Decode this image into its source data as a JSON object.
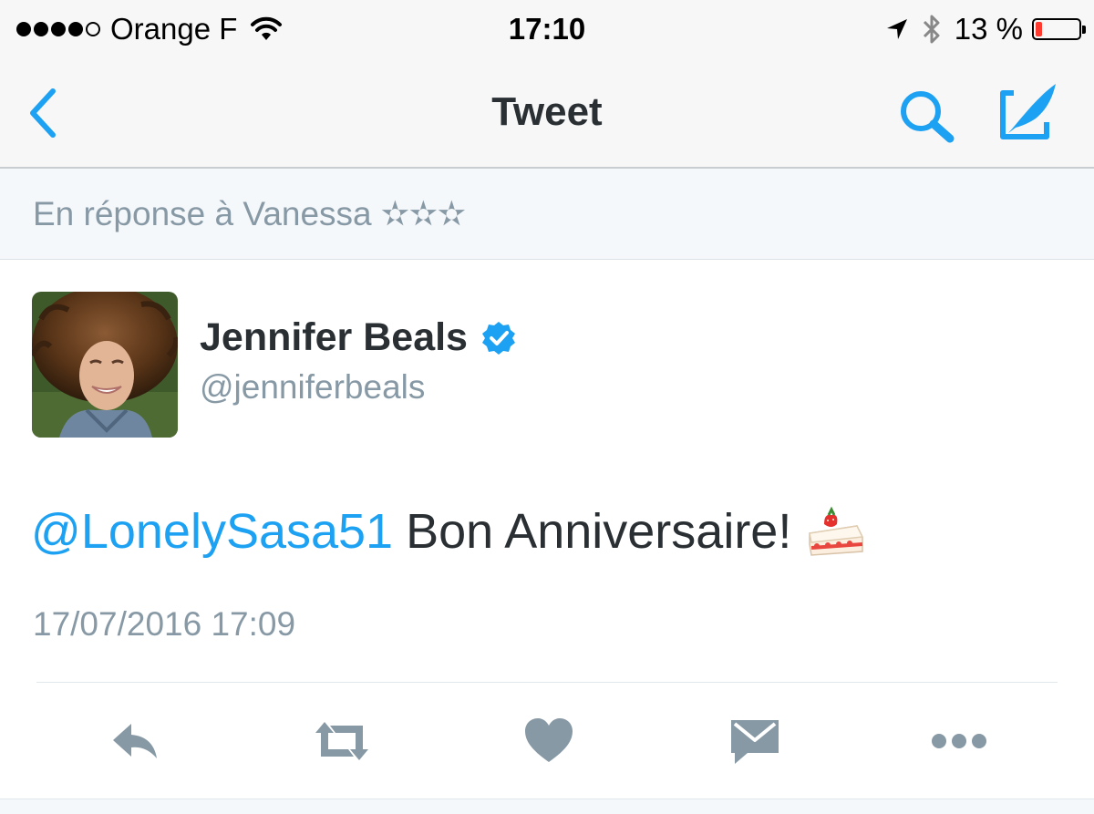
{
  "status_bar": {
    "signal_dots_filled": 4,
    "signal_dots_total": 5,
    "carrier": "Orange F",
    "time": "17:10",
    "battery_percent_label": "13 %",
    "battery_level": 0.13,
    "icons": [
      "wifi-icon",
      "location-arrow-icon",
      "bluetooth-icon",
      "battery-icon"
    ]
  },
  "nav": {
    "title": "Tweet",
    "icons": [
      "back-chevron-icon",
      "search-icon",
      "compose-icon"
    ]
  },
  "reply_context": {
    "text": "En réponse à Vanessa ✫✫✫"
  },
  "tweet": {
    "author_name": "Jennifer Beals",
    "author_handle": "@jenniferbeals",
    "verified": true,
    "mention": "@LonelySasa51",
    "text": "Bon Anniversaire!",
    "emoji": "shortcake-icon",
    "timestamp": "17/07/2016 17:09"
  },
  "actions": {
    "icons": [
      "reply-icon",
      "retweet-icon",
      "like-icon",
      "direct-message-icon",
      "more-icon"
    ]
  },
  "colors": {
    "accent": "#1da1f2",
    "action_icon": "#8899a6",
    "text": "#292f33",
    "muted": "#8899a6",
    "battery_low": "#ff3b30"
  }
}
